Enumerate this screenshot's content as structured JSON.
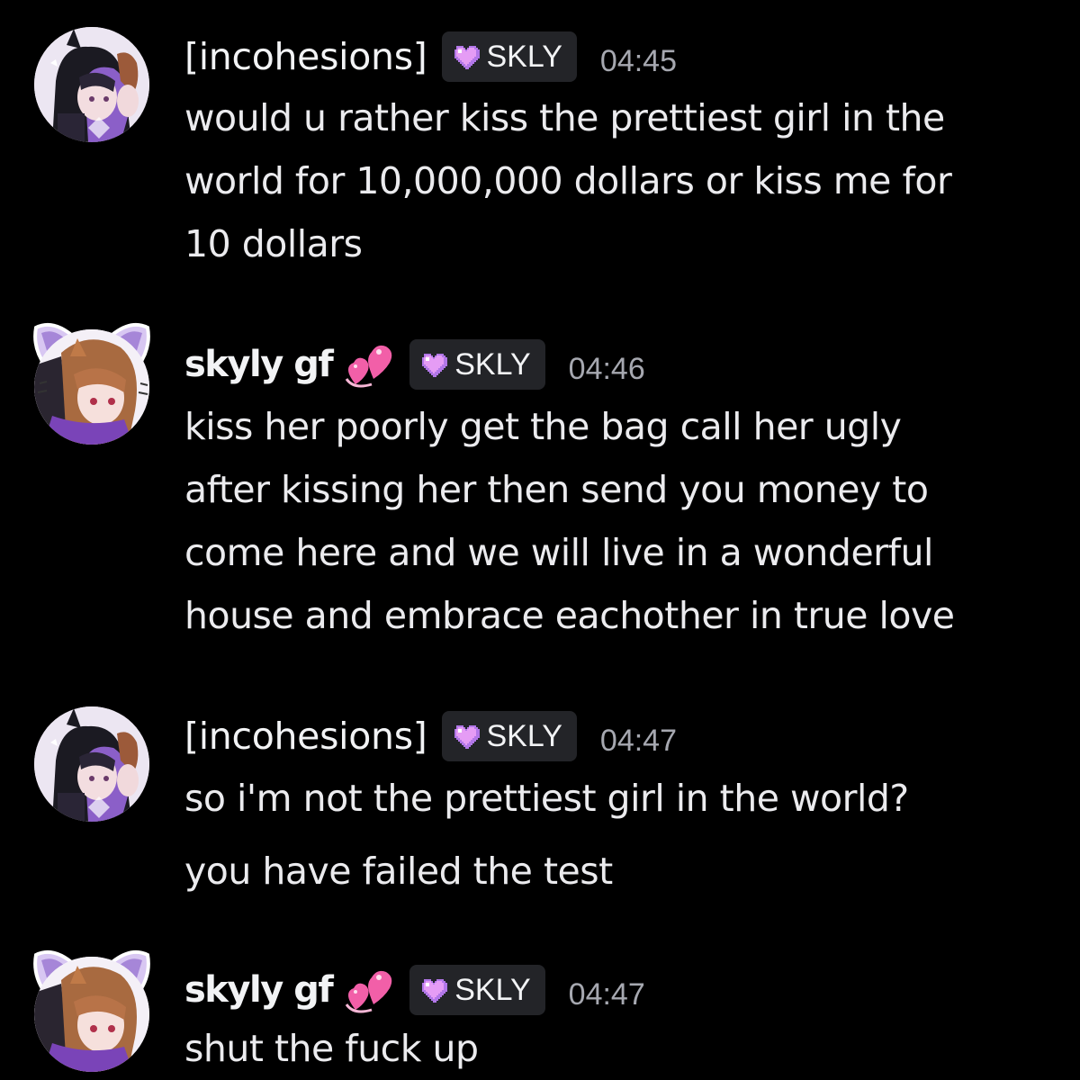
{
  "messages": [
    {
      "username": "[incohesions]",
      "tag": "SKLY",
      "timestamp": "04:45",
      "lines": [
        "would u rather kiss the prettiest girl in the",
        "world for 10,000,000 dollars or kiss me for",
        "10 dollars"
      ]
    },
    {
      "username": "skyly gf",
      "tag": "SKLY",
      "timestamp": "04:46",
      "lines": [
        "kiss her poorly get the bag call her ugly",
        "after kissing her then send you money to",
        "come here and we will live in a wonderful",
        "house and embrace eachother in true love"
      ]
    },
    {
      "username": "[incohesions]",
      "tag": "SKLY",
      "timestamp": "04:47",
      "lines": [
        "so i'm not the prettiest girl in the world?",
        "you have failed the test"
      ]
    },
    {
      "username": "skyly gf",
      "tag": "SKLY",
      "timestamp": "04:47",
      "lines": [
        "shut the fuck up"
      ]
    }
  ],
  "colors": {
    "background": "#000000",
    "text": "#ebebee",
    "timestamp": "#a6a8b0",
    "tag_bg": "#232428",
    "heart": "#e59cf5",
    "deco_heart": "#f25fa8"
  },
  "icons": {
    "tag_icon": "pixel-heart-icon",
    "name_decoration": "two-hearts-icon"
  }
}
